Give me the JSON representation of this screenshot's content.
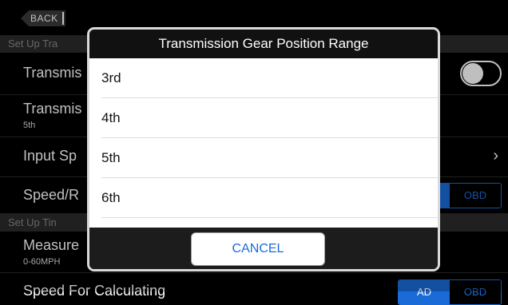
{
  "nav": {
    "back_label": "BACK"
  },
  "sections": [
    {
      "header": "Set Up Tra"
    },
    {
      "header": "Set Up Tin"
    }
  ],
  "rows": {
    "r1": {
      "title": "Transmis"
    },
    "r2": {
      "title": "Transmis",
      "subtitle": "5th"
    },
    "r3": {
      "title": "Input Sp"
    },
    "r4": {
      "title": "Speed/R",
      "seg_on": "",
      "seg_off": "OBD"
    },
    "r5": {
      "title": "Measure",
      "subtitle": "0-60MPH"
    },
    "r6": {
      "title": "Speed For Calculating",
      "seg_on": "AD",
      "seg_off": "OBD"
    }
  },
  "modal": {
    "title": "Transmission Gear Position Range",
    "options": [
      "3rd",
      "4th",
      "5th",
      "6th"
    ],
    "cancel_label": "CANCEL"
  },
  "colors": {
    "accent": "#1a6bd8",
    "header_bg": "#2b2b2b",
    "modal_border": "#d9d9d9"
  }
}
